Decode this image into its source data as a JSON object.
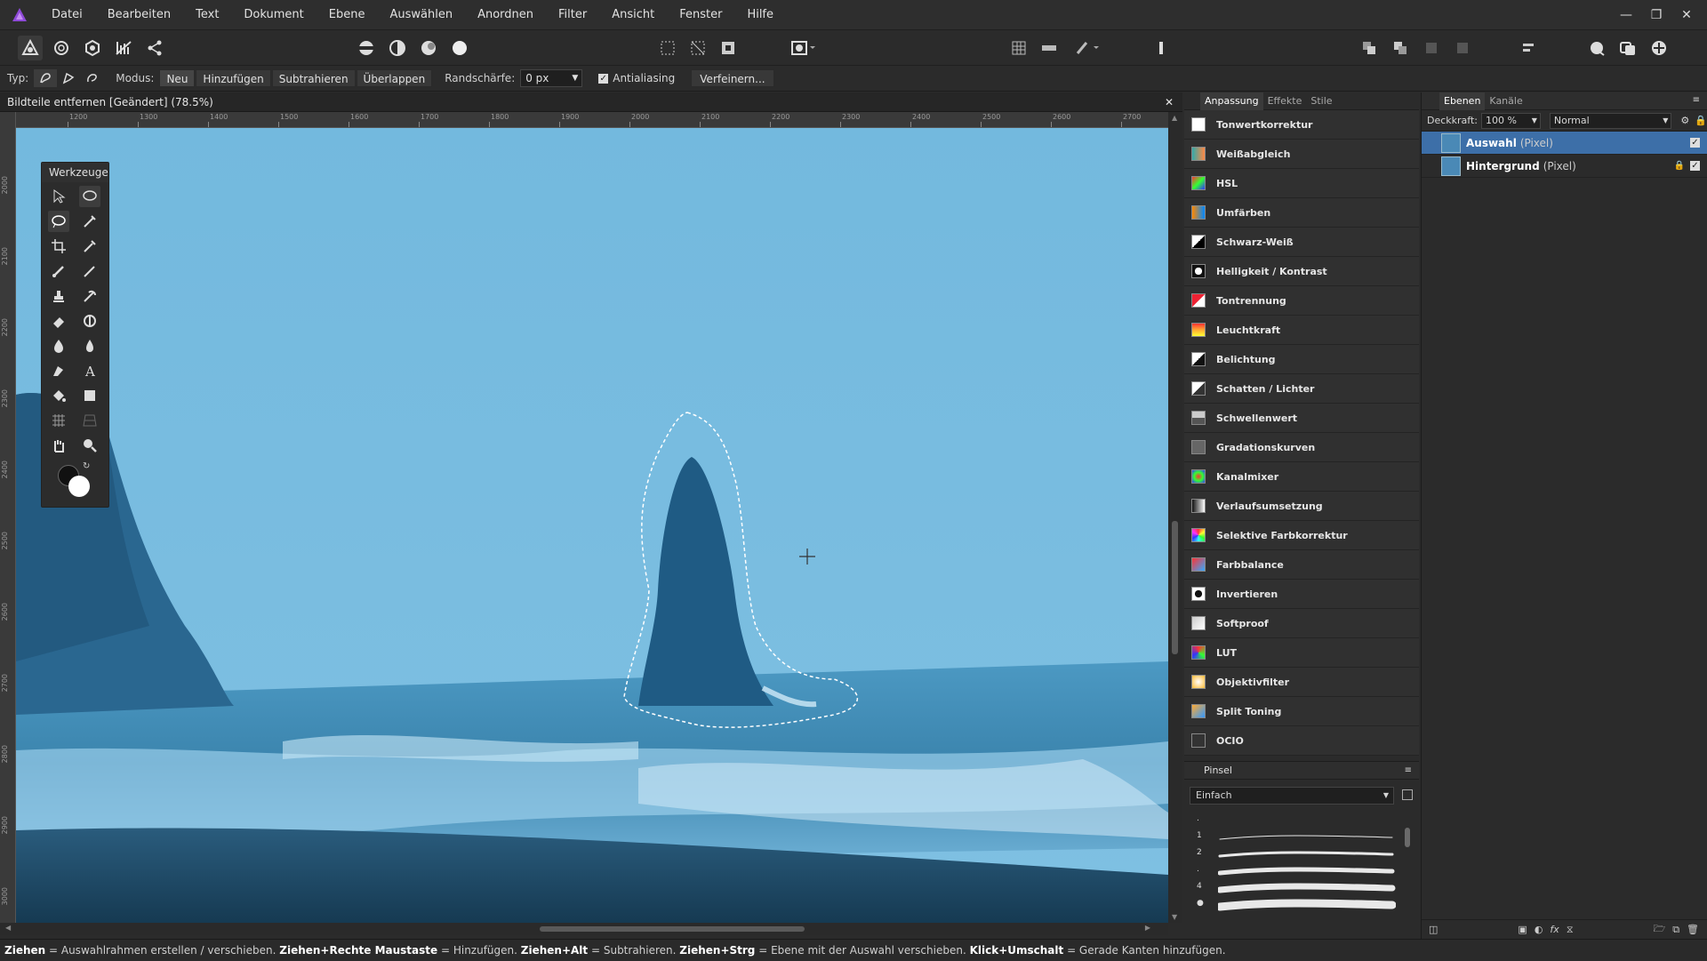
{
  "menubar": {
    "items": [
      "Datei",
      "Bearbeiten",
      "Text",
      "Dokument",
      "Ebene",
      "Auswählen",
      "Anordnen",
      "Filter",
      "Ansicht",
      "Fenster",
      "Hilfe"
    ]
  },
  "context_bar": {
    "typ_label": "Typ:",
    "modus_label": "Modus:",
    "modes": [
      "Neu",
      "Hinzufügen",
      "Subtrahieren",
      "Überlappen"
    ],
    "active_mode": "Neu",
    "feather_label": "Randschärfe:",
    "feather_value": "0 px",
    "antialias_label": "Antialiasing",
    "antialias_checked": true,
    "refine_label": "Verfeinern..."
  },
  "document": {
    "tab_title": "Bildteile entfernen [Geändert] (78.5%)"
  },
  "rulers": {
    "top": [
      "1200",
      "1300",
      "1400",
      "1500",
      "1600",
      "1700",
      "1800",
      "1900",
      "2000",
      "2100",
      "2200",
      "2300",
      "2400",
      "2500",
      "2600",
      "2700"
    ],
    "left": [
      "2000",
      "2100",
      "2200",
      "2300",
      "2400",
      "2500",
      "2600",
      "2700",
      "2800",
      "2900",
      "3000"
    ]
  },
  "tools_panel": {
    "title": "Werkzeuge"
  },
  "adjustment_panel": {
    "tabs": [
      "Anpassung",
      "Effekte",
      "Stile"
    ],
    "active_tab": "Anpassung",
    "items": [
      {
        "label": "Tonwertkorrektur",
        "icon": "levels-icon"
      },
      {
        "label": "Weißabgleich",
        "icon": "white-balance-icon"
      },
      {
        "label": "HSL",
        "icon": "hsl-icon"
      },
      {
        "label": "Umfärben",
        "icon": "recolor-icon"
      },
      {
        "label": "Schwarz-Weiß",
        "icon": "black-white-icon"
      },
      {
        "label": "Helligkeit / Kontrast",
        "icon": "brightness-contrast-icon"
      },
      {
        "label": "Tontrennung",
        "icon": "posterize-icon"
      },
      {
        "label": "Leuchtkraft",
        "icon": "vibrance-icon"
      },
      {
        "label": "Belichtung",
        "icon": "exposure-icon"
      },
      {
        "label": "Schatten / Lichter",
        "icon": "shadows-highlights-icon"
      },
      {
        "label": "Schwellenwert",
        "icon": "threshold-icon"
      },
      {
        "label": "Gradationskurven",
        "icon": "curves-icon"
      },
      {
        "label": "Kanalmixer",
        "icon": "channel-mixer-icon"
      },
      {
        "label": "Verlaufsumsetzung",
        "icon": "gradient-map-icon"
      },
      {
        "label": "Selektive Farbkorrektur",
        "icon": "selective-color-icon"
      },
      {
        "label": "Farbbalance",
        "icon": "color-balance-icon"
      },
      {
        "label": "Invertieren",
        "icon": "invert-icon"
      },
      {
        "label": "Softproof",
        "icon": "soft-proof-icon"
      },
      {
        "label": "LUT",
        "icon": "lut-icon"
      },
      {
        "label": "Objektivfilter",
        "icon": "lens-filter-icon"
      },
      {
        "label": "Split Toning",
        "icon": "split-toning-icon"
      },
      {
        "label": "OCIO",
        "icon": "ocio-icon"
      }
    ]
  },
  "brush_panel": {
    "title": "Pinsel",
    "category": "Einfach",
    "sizes": [
      ".",
      "1",
      "2",
      ".",
      "4",
      "●"
    ]
  },
  "layers_panel": {
    "tabs": [
      "Ebenen",
      "Kanäle"
    ],
    "active_tab": "Ebenen",
    "opacity_label": "Deckkraft:",
    "opacity_value": "100 %",
    "blend_mode": "Normal",
    "layers": [
      {
        "name": "Auswahl",
        "type": "(Pixel)",
        "selected": true,
        "locked": false,
        "visible": true
      },
      {
        "name": "Hintergrund",
        "type": "(Pixel)",
        "selected": false,
        "locked": true,
        "visible": true
      }
    ]
  },
  "statusbar": {
    "parts": [
      {
        "key": "Ziehen",
        "desc": " = Auswahlrahmen erstellen / verschieben. "
      },
      {
        "key": "Ziehen+Rechte Maustaste",
        "desc": " = Hinzufügen. "
      },
      {
        "key": "Ziehen+Alt",
        "desc": " = Subtrahieren. "
      },
      {
        "key": "Ziehen+Strg",
        "desc": " = Ebene mit der Auswahl verschieben. "
      },
      {
        "key": "Klick+Umschalt",
        "desc": " = Gerade Kanten hinzufügen."
      }
    ]
  },
  "colors": {
    "accent": "#4a8fd4",
    "selected_layer": "#3d6fa8",
    "sky": "#6bb3d9",
    "sea": "#3f8db8",
    "sand": "#1f4a68"
  }
}
